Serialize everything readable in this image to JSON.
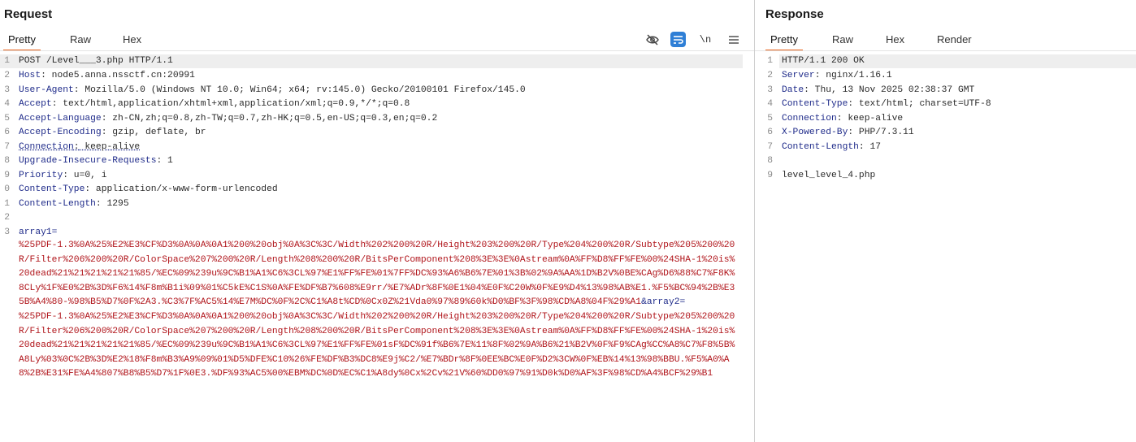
{
  "request": {
    "title": "Request",
    "tabs": [
      "Pretty",
      "Raw",
      "Hex"
    ],
    "active_tab": "Pretty",
    "tool_icons": [
      "eye-slash-icon",
      "wrap-icon",
      "newline-icon",
      "menu-icon"
    ],
    "newline_label": "\\n",
    "lines": [
      {
        "n": "1",
        "text": "POST /Level___3.php HTTP/1.1"
      },
      {
        "n": "2",
        "key": "Host",
        "value": " node5.anna.nssctf.cn:20991"
      },
      {
        "n": "3",
        "key": "User-Agent",
        "value": " Mozilla/5.0 (Windows NT 10.0; Win64; x64; rv:145.0) Gecko/20100101 Firefox/145.0"
      },
      {
        "n": "4",
        "key": "Accept",
        "value": " text/html,application/xhtml+xml,application/xml;q=0.9,*/*;q=0.8"
      },
      {
        "n": "5",
        "key": "Accept-Language",
        "value": " zh-CN,zh;q=0.8,zh-TW;q=0.7,zh-HK;q=0.5,en-US;q=0.3,en;q=0.2"
      },
      {
        "n": "6",
        "key": "Accept-Encoding",
        "value": " gzip, deflate, br"
      },
      {
        "n": "7",
        "key": "Connection",
        "value": " keep-alive"
      },
      {
        "n": "8",
        "key": "Upgrade-Insecure-Requests",
        "value": " 1"
      },
      {
        "n": "9",
        "key": "Priority",
        "value": " u=0, i"
      },
      {
        "n": "0",
        "key": "Content-Type",
        "value": " application/x-www-form-urlencoded"
      },
      {
        "n": "1",
        "key": "Content-Length",
        "value": " 1295"
      },
      {
        "n": "2",
        "text": ""
      },
      {
        "n": "3",
        "param": "array1="
      }
    ],
    "body_part1": "%25PDF-1.3%0A%25%E2%E3%CF%D3%0A%0A%0A1%200%20obj%0A%3C%3C/Width%202%200%20R/Height%203%200%20R/Type%204%200%20R/Subtype%205%200%20R/Filter%206%200%20R/ColorSpace%207%200%20R/Length%208%200%20R/BitsPerComponent%208%3E%3E%0Astream%0A%FF%D8%FF%FE%00%24SHA-1%20is%20dead%21%21%21%21%21%85/%EC%09%239u%9C%B1%A1%C6%3CL%97%E1%FF%FE%01%7FF%DC%93%A6%B6%7E%01%3B%02%9A%AA%1D%B2V%0BE%CAg%D6%88%C7%F8K%8CLy%1F%E0%2B%3D%F6%14%F8m%B1i%09%01%C5kE%C1S%0A%FE%DF%B7%608%E9rr/%E7%ADr%8F%0E1%04%E0F%C20W%0F%E9%D4%13%98%AB%E1.%F5%BC%94%2B%E35B%A4%80-%98%B5%D7%0F%2A3.%C3%7F%AC5%14%E7M%DC%0F%2C%C1%A8t%CD%0Cx0Z%21Vda0%97%89%60k%D0%BF%3F%98%CD%A8%04F%29%A1",
    "body_sep": "&",
    "body_param2": "array2",
    "body_eq": "=",
    "body_part2": "%25PDF-1.3%0A%25%E2%E3%CF%D3%0A%0A%0A1%200%20obj%0A%3C%3C/Width%202%200%20R/Height%203%200%20R/Type%204%200%20R/Subtype%205%200%20R/Filter%206%200%20R/ColorSpace%207%200%20R/Length%208%200%20R/BitsPerComponent%208%3E%3E%0Astream%0A%FF%D8%FF%FE%00%24SHA-1%20is%20dead%21%21%21%21%21%85/%EC%09%239u%9C%B1%A1%C6%3CL%97%E1%FF%FE%01sF%DC%91f%B6%7E%11%8F%02%9A%B6%21%B2V%0F%F9%CAg%CC%A8%C7%F8%5B%A8Ly%03%0C%2B%3D%E2%18%F8m%B3%A9%09%01%D5%DFE%C10%26%FE%DF%B3%DC8%E9j%C2/%E7%BDr%8F%0EE%BC%E0F%D2%3CW%0F%EB%14%13%98%BBU.%F5%A0%A8%2B%E31%FE%A4%807%B8%B5%D7%1F%0E3.%DF%93%AC5%00%EBM%DC%0D%EC%C1%A8dy%0Cx%2Cv%21V%60%DD0%97%91%D0k%D0%AF%3F%98%CD%A4%BCF%29%B1"
  },
  "response": {
    "title": "Response",
    "tabs": [
      "Pretty",
      "Raw",
      "Hex",
      "Render"
    ],
    "active_tab": "Pretty",
    "lines": [
      {
        "n": "1",
        "text": "HTTP/1.1 200 OK"
      },
      {
        "n": "2",
        "key": "Server",
        "value": " nginx/1.16.1"
      },
      {
        "n": "3",
        "key": "Date",
        "value": " Thu, 13 Nov 2025 02:38:37 GMT"
      },
      {
        "n": "4",
        "key": "Content-Type",
        "value": " text/html; charset=UTF-8"
      },
      {
        "n": "5",
        "key": "Connection",
        "value": " keep-alive"
      },
      {
        "n": "6",
        "key": "X-Powered-By",
        "value": " PHP/7.3.11"
      },
      {
        "n": "7",
        "key": "Content-Length",
        "value": " 17"
      },
      {
        "n": "8",
        "text": ""
      },
      {
        "n": "9",
        "text": "level_level_4.php"
      }
    ]
  },
  "colors": {
    "accent": "#e8631c",
    "header_key": "#1f2b8a",
    "body_red": "#b0141a",
    "wrap_button": "#2f7fd6"
  }
}
